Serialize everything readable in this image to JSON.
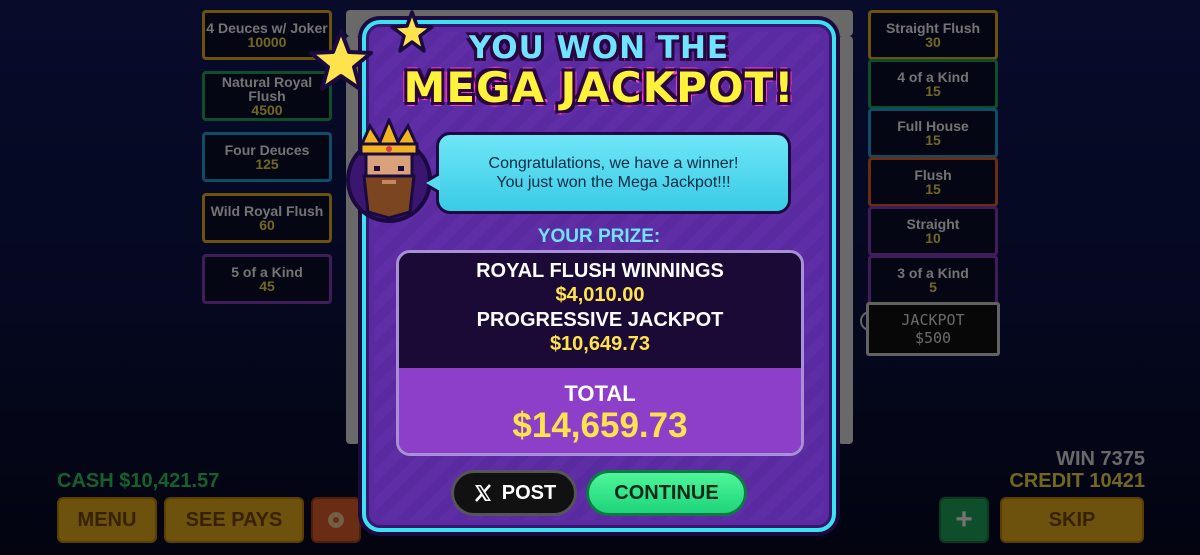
{
  "left_paytable": [
    {
      "name": "4 Deuces w/ Joker",
      "value": "10000",
      "color": "#f2b51f"
    },
    {
      "name": "Natural Royal Flush",
      "value": "4500",
      "color": "#1fae5f"
    },
    {
      "name": "Four Deuces",
      "value": "125",
      "color": "#23a9e6"
    },
    {
      "name": "Wild Royal Flush",
      "value": "60",
      "color": "#f2b51f"
    },
    {
      "name": "5 of a Kind",
      "value": "45",
      "color": "#8e3fc9"
    }
  ],
  "right_paytable": [
    {
      "name": "Straight Flush",
      "value": "30",
      "color": "#f2b51f"
    },
    {
      "name": "4 of a Kind",
      "value": "15",
      "color": "#1fae5f"
    },
    {
      "name": "Full House",
      "value": "15",
      "color": "#23a9e6"
    },
    {
      "name": "Flush",
      "value": "15",
      "color": "#e8642a"
    },
    {
      "name": "Straight",
      "value": "10",
      "color": "#8e3fc9"
    },
    {
      "name": "3 of a Kind",
      "value": "5",
      "color": "#8e3fc9"
    }
  ],
  "jackpot_box": {
    "label": "JACKPOT",
    "value": "$500"
  },
  "status": {
    "cash": "CASH $10,421.57",
    "win": "WIN 7375",
    "credit": "CREDIT 10421"
  },
  "bottom_buttons": {
    "menu": "MENU",
    "see_pays": "SEE PAYS",
    "plus": "+",
    "skip": "SKIP"
  },
  "modal": {
    "title_line1": "YOU WON THE",
    "title_line2": "MEGA JACKPOT!",
    "message_line1": "Congratulations, we have a winner!",
    "message_line2": "You just won the Mega Jackpot!!!",
    "prize_label": "YOUR PRIZE:",
    "royal_label": "ROYAL FLUSH WINNINGS",
    "royal_value": "$4,010.00",
    "progressive_label": "PROGRESSIVE JACKPOT",
    "progressive_value": "$10,649.73",
    "total_label": "TOTAL",
    "total_value": "$14,659.73",
    "post_label": "POST",
    "continue_label": "CONTINUE"
  },
  "icons": [
    "star-icon",
    "king-avatar-icon",
    "x-logo-icon",
    "gear-icon",
    "info-icon"
  ],
  "colors": {
    "accent_cyan": "#39e3ef",
    "modal_purple": "#5a2aa0",
    "gold": "#ffe34d",
    "green": "#1ed47a"
  }
}
